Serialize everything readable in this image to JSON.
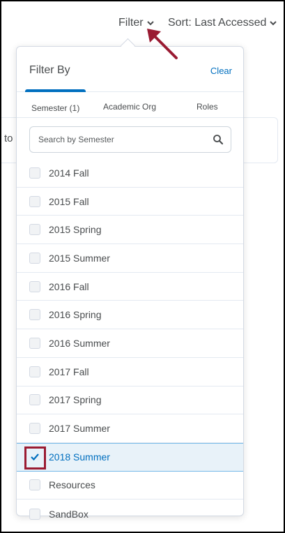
{
  "topbar": {
    "filter_label": "Filter",
    "sort_label": "Sort: Last Accessed"
  },
  "background": {
    "partial_text": "to"
  },
  "panel": {
    "title": "Filter By",
    "clear_label": "Clear",
    "tabs": [
      {
        "label": "Semester (1)",
        "active": true
      },
      {
        "label": "Academic Org",
        "active": false
      },
      {
        "label": "Roles",
        "active": false
      }
    ],
    "search_placeholder": "Search by Semester",
    "items": [
      {
        "label": "2014 Fall",
        "checked": false
      },
      {
        "label": "2015 Fall",
        "checked": false
      },
      {
        "label": "2015 Spring",
        "checked": false
      },
      {
        "label": "2015 Summer",
        "checked": false
      },
      {
        "label": "2016 Fall",
        "checked": false
      },
      {
        "label": "2016 Spring",
        "checked": false
      },
      {
        "label": "2016 Summer",
        "checked": false
      },
      {
        "label": "2017 Fall",
        "checked": false
      },
      {
        "label": "2017 Spring",
        "checked": false
      },
      {
        "label": "2017 Summer",
        "checked": false
      },
      {
        "label": "2018 Summer",
        "checked": true
      },
      {
        "label": "Resources",
        "checked": false
      },
      {
        "label": "SandBox",
        "checked": false
      }
    ]
  },
  "colors": {
    "accent": "#006fbf",
    "annotation": "#9a1b32",
    "text": "#494c4e"
  }
}
